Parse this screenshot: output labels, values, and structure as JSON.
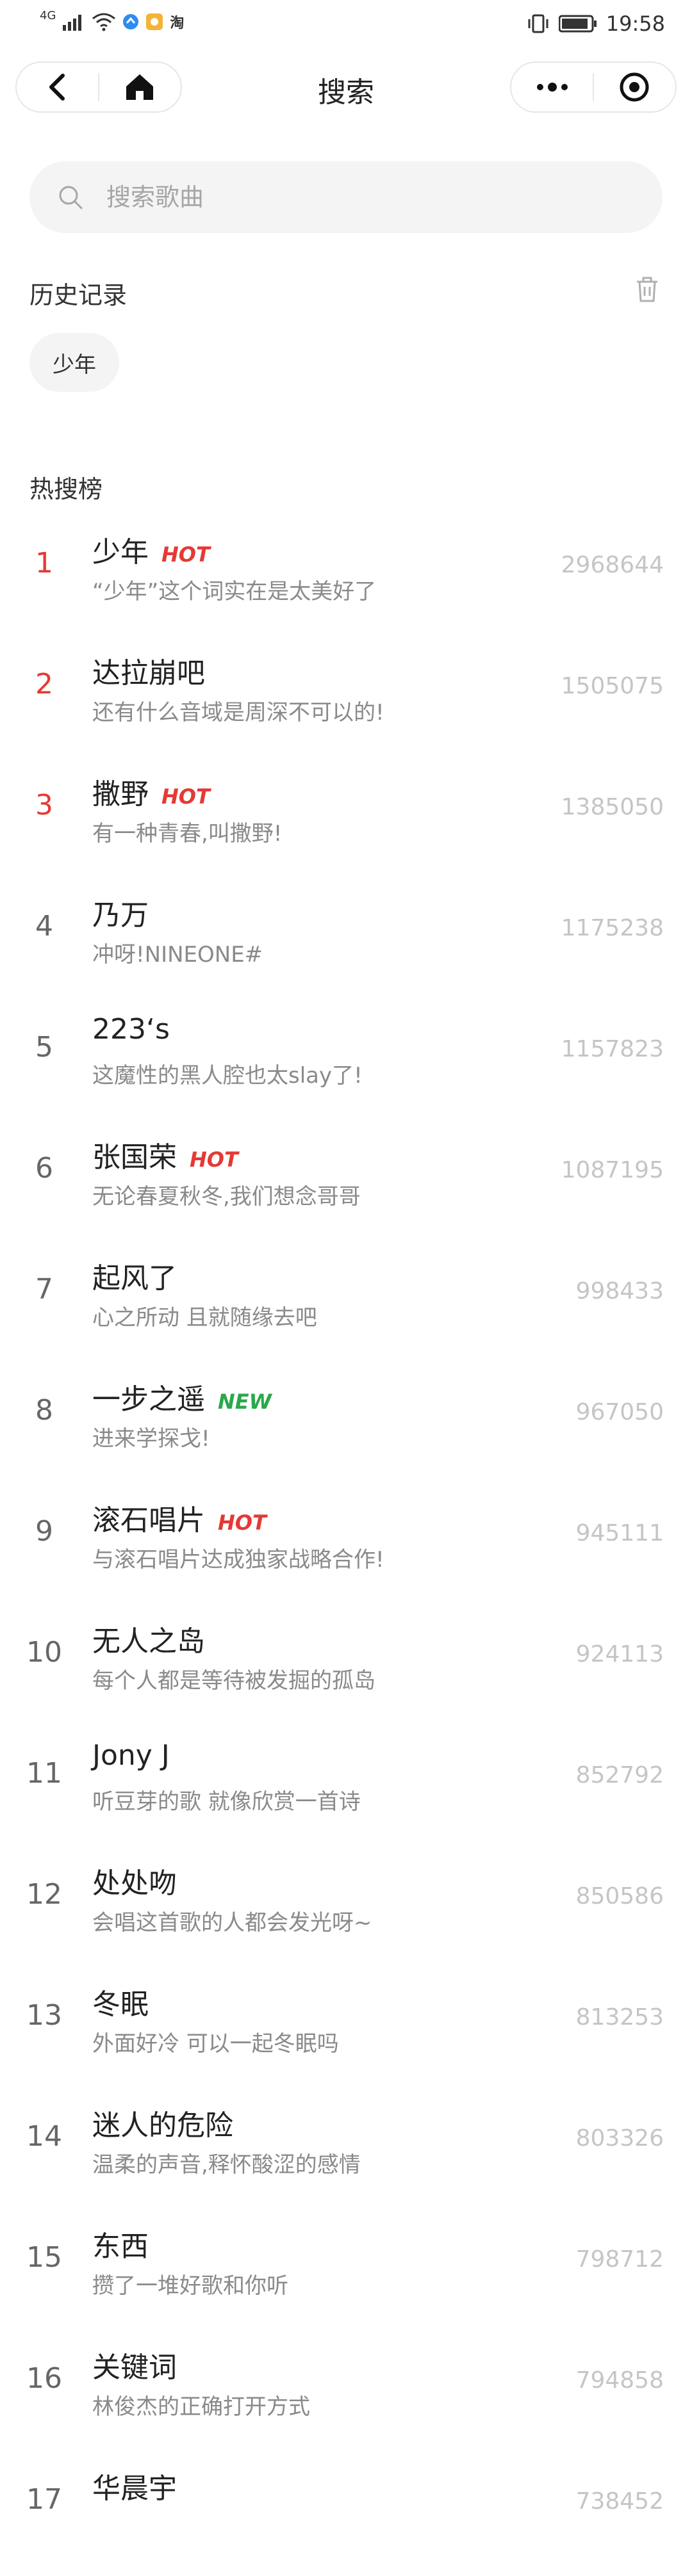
{
  "status": {
    "left_icons": [
      "signal-icon",
      "wifi-icon",
      "app-badge-icon",
      "app-badge-icon",
      "taobao-icon"
    ],
    "network": "4G",
    "taobao": "淘",
    "time": "19:58"
  },
  "header": {
    "title": "搜索"
  },
  "search": {
    "placeholder": "搜索歌曲"
  },
  "history": {
    "title": "历史记录",
    "items": [
      "少年"
    ]
  },
  "hot": {
    "title": "热搜榜",
    "items": [
      {
        "rank": "1",
        "name": "少年",
        "tag": "HOT",
        "desc": "“少年”这个词实在是太美好了",
        "count": "2968644"
      },
      {
        "rank": "2",
        "name": "达拉崩吧",
        "tag": "",
        "desc": "还有什么音域是周深不可以的!",
        "count": "1505075"
      },
      {
        "rank": "3",
        "name": "撒野",
        "tag": "HOT",
        "desc": "有一种青春,叫撒野!",
        "count": "1385050"
      },
      {
        "rank": "4",
        "name": "乃万",
        "tag": "",
        "desc": "冲呀!NINEONE#",
        "count": "1175238"
      },
      {
        "rank": "5",
        "name": "223‘s",
        "tag": "",
        "desc": "这魔性的黑人腔也太slay了!",
        "count": "1157823"
      },
      {
        "rank": "6",
        "name": "张国荣",
        "tag": "HOT",
        "desc": "无论春夏秋冬,我们想念哥哥",
        "count": "1087195"
      },
      {
        "rank": "7",
        "name": "起风了",
        "tag": "",
        "desc": "心之所动 且就随缘去吧",
        "count": "998433"
      },
      {
        "rank": "8",
        "name": "一步之遥",
        "tag": "NEW",
        "desc": "进来学探戈!",
        "count": "967050"
      },
      {
        "rank": "9",
        "name": "滚石唱片",
        "tag": "HOT",
        "desc": "与滚石唱片达成独家战略合作!",
        "count": "945111"
      },
      {
        "rank": "10",
        "name": "无人之岛",
        "tag": "",
        "desc": "每个人都是等待被发掘的孤岛",
        "count": "924113"
      },
      {
        "rank": "11",
        "name": "Jony J",
        "tag": "",
        "desc": "听豆芽的歌 就像欣赏一首诗",
        "count": "852792"
      },
      {
        "rank": "12",
        "name": "处处吻",
        "tag": "",
        "desc": "会唱这首歌的人都会发光呀~",
        "count": "850586"
      },
      {
        "rank": "13",
        "name": "冬眠",
        "tag": "",
        "desc": "外面好冷 可以一起冬眠吗",
        "count": "813253"
      },
      {
        "rank": "14",
        "name": "迷人的危险",
        "tag": "",
        "desc": "温柔的声音,释怀酸涩的感情",
        "count": "803326"
      },
      {
        "rank": "15",
        "name": "东西",
        "tag": "",
        "desc": "攒了一堆好歌和你听",
        "count": "798712"
      },
      {
        "rank": "16",
        "name": "关键词",
        "tag": "",
        "desc": "林俊杰的正确打开方式",
        "count": "794858"
      },
      {
        "rank": "17",
        "name": "华晨宇",
        "tag": "",
        "desc": "",
        "count": "738452"
      }
    ]
  },
  "colors": {
    "top_rank": "#e53935",
    "hot_tag": "#e53935",
    "new_tag": "#2aa84a"
  }
}
